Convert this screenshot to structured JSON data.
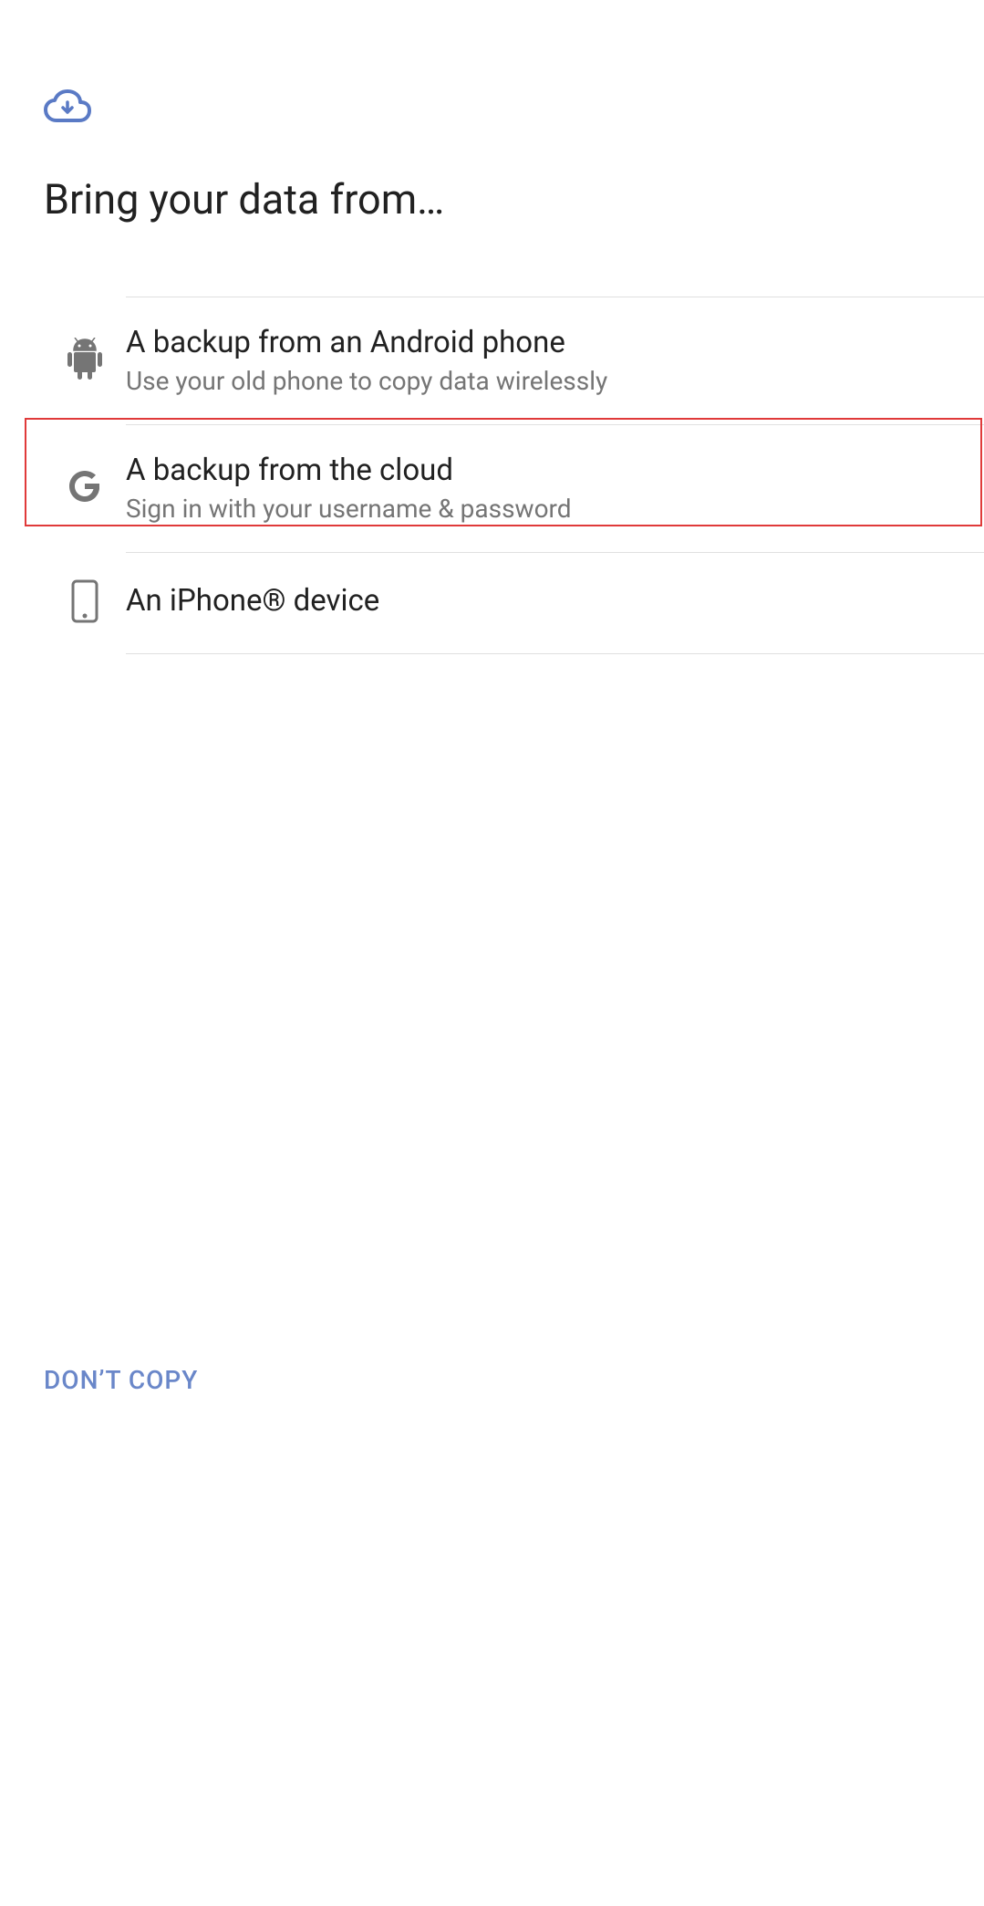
{
  "header": {
    "title": "Bring your data from…"
  },
  "options": [
    {
      "icon": "android-icon",
      "title": "A backup from an Android phone",
      "subtitle": "Use your old phone to copy data wirelessly"
    },
    {
      "icon": "google-icon",
      "title": "A backup from the cloud",
      "subtitle": "Sign in with your username & password",
      "highlighted": true
    },
    {
      "icon": "phone-icon",
      "title": "An iPhone® device",
      "subtitle": ""
    }
  ],
  "footer": {
    "dont_copy_label": "DON’T COPY"
  },
  "colors": {
    "accent": "#6a87c9",
    "text_primary": "#212121",
    "text_secondary": "#757575",
    "highlight_border": "#e03a3a",
    "cloud_icon": "#5a7ac5"
  }
}
